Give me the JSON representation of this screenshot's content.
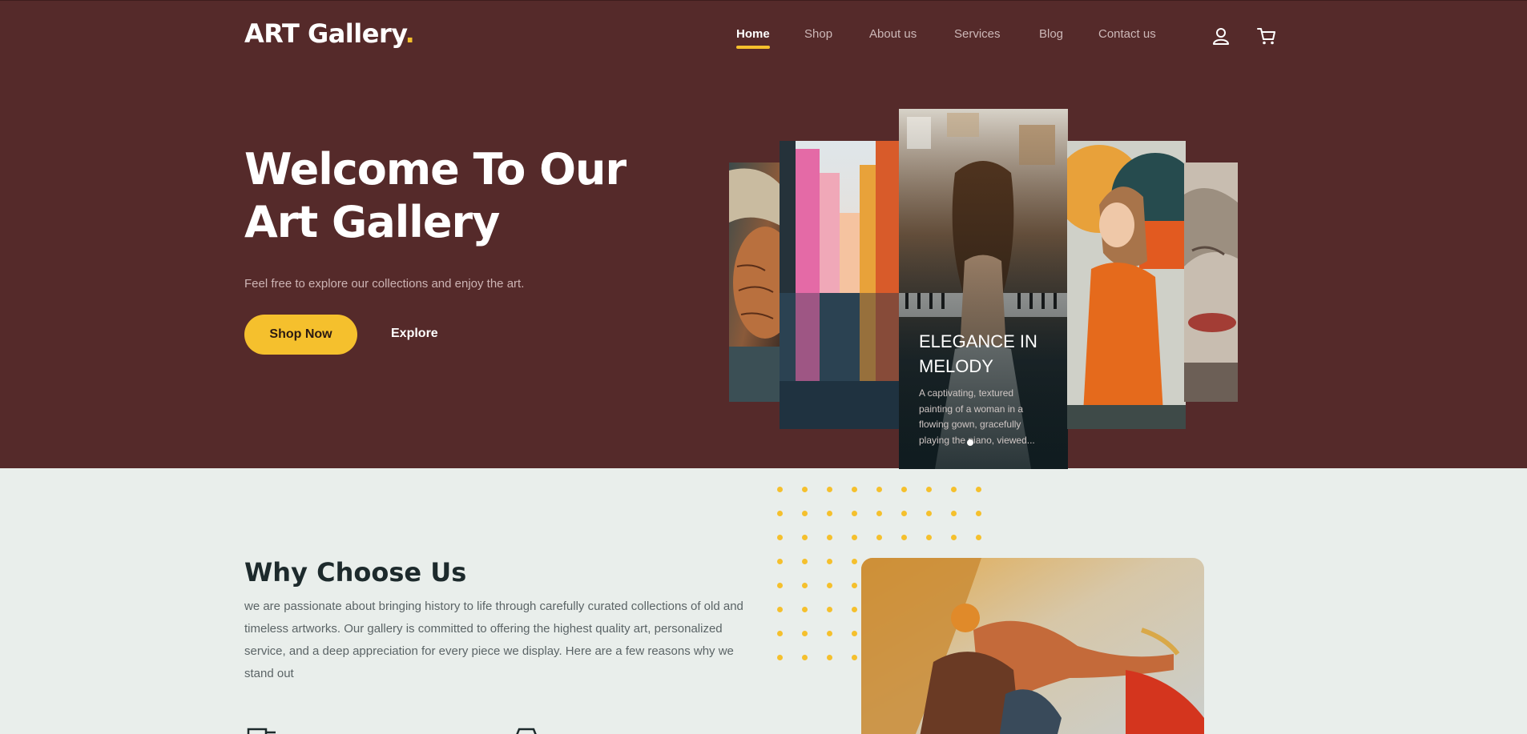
{
  "brand": {
    "name": "ART Gallery",
    "dot": "."
  },
  "nav": {
    "items": [
      {
        "label": "Home",
        "active": true
      },
      {
        "label": "Shop"
      },
      {
        "label": "About us"
      },
      {
        "label": "Services"
      },
      {
        "label": "Blog"
      },
      {
        "label": "Contact us"
      }
    ],
    "icons": [
      "user-icon",
      "cart-icon"
    ]
  },
  "hero": {
    "title": "Welcome To Our Art Gallery",
    "subtitle": "Feel free to explore our collections and enjoy the art.",
    "primary_button": "Shop Now",
    "secondary_button": "Explore"
  },
  "carousel": {
    "active_card": {
      "title": "ELEGANCE IN MELODY",
      "description": "A captivating, textured painting of a woman in a flowing gown, gracefully playing the piano, viewed..."
    }
  },
  "why_choose_us": {
    "title": "Why Choose Us",
    "text": "we are passionate about bringing history to life through carefully curated collections of old and timeless artworks. Our gallery is committed to offering the highest quality art, personalized service, and a deep appreciation for every piece we display. Here are a few reasons why we stand out"
  },
  "colors": {
    "hero_bg": "#552a2a",
    "accent": "#f5c02d",
    "section_bg": "#e9eeeb",
    "heading": "#1d2a2c"
  }
}
